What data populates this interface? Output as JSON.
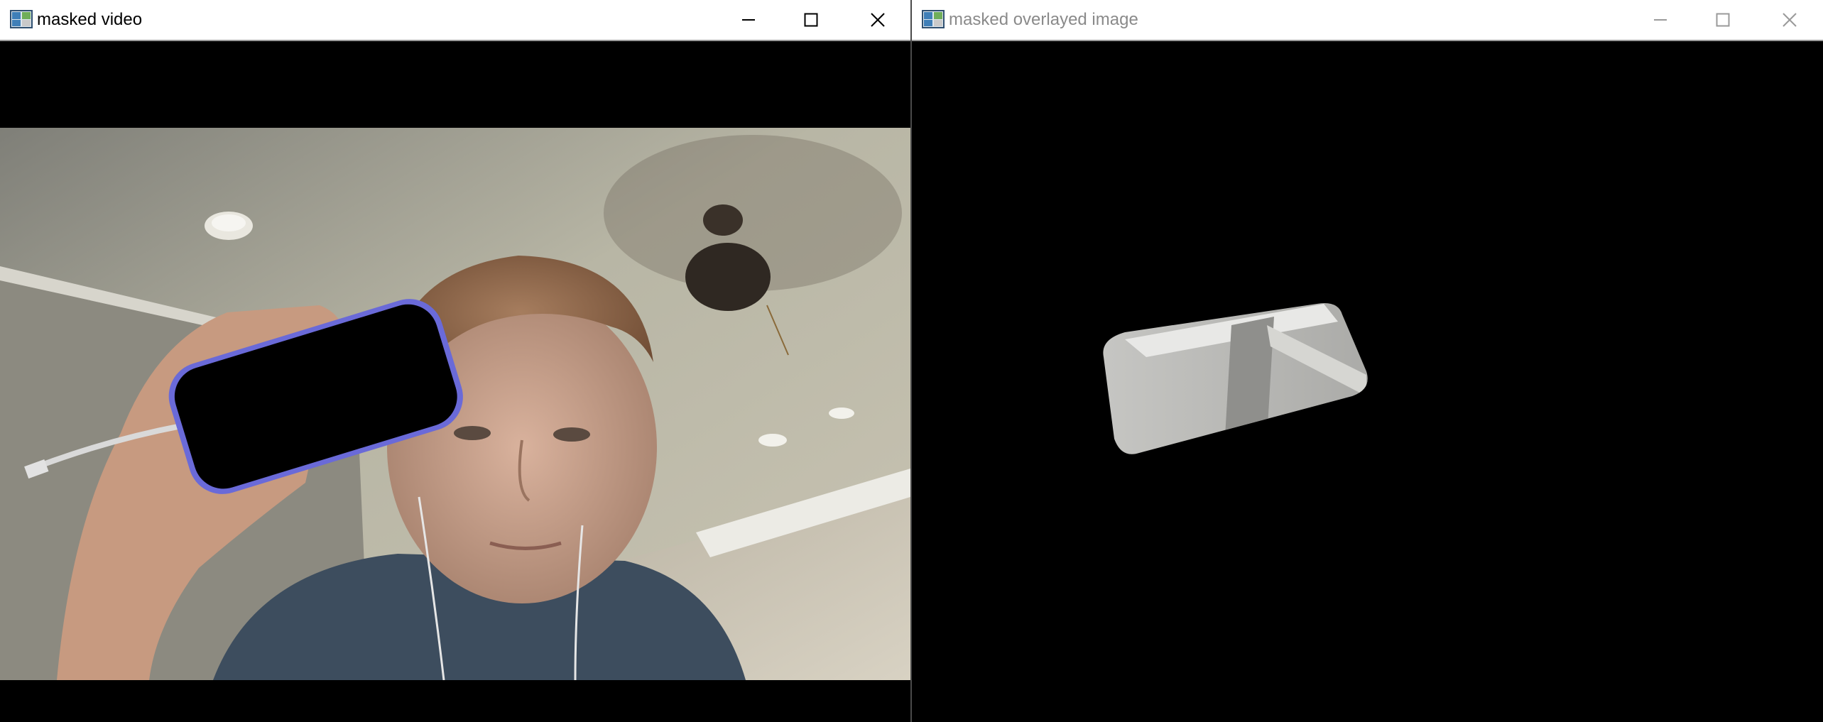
{
  "left_window": {
    "title": "masked video",
    "icon": "image-viewer-app-icon",
    "active": true,
    "controls": {
      "minimize_icon": "minimize-icon",
      "maximize_icon": "maximize-icon",
      "close_icon": "close-icon"
    },
    "content": {
      "description_icon": "webcam-frame-with-masked-phone"
    }
  },
  "right_window": {
    "title": "masked overlayed image",
    "icon": "image-viewer-app-icon",
    "active": false,
    "controls": {
      "minimize_icon": "minimize-icon",
      "maximize_icon": "maximize-icon",
      "close_icon": "close-icon"
    },
    "content": {
      "description_icon": "masked-phone-region-overlay"
    }
  },
  "colors": {
    "titlebar_bg": "#ffffff",
    "active_title": "#000000",
    "inactive_title": "#8a8a8a",
    "content_bg": "#000000",
    "phone_outline": "#6a6ad8"
  }
}
